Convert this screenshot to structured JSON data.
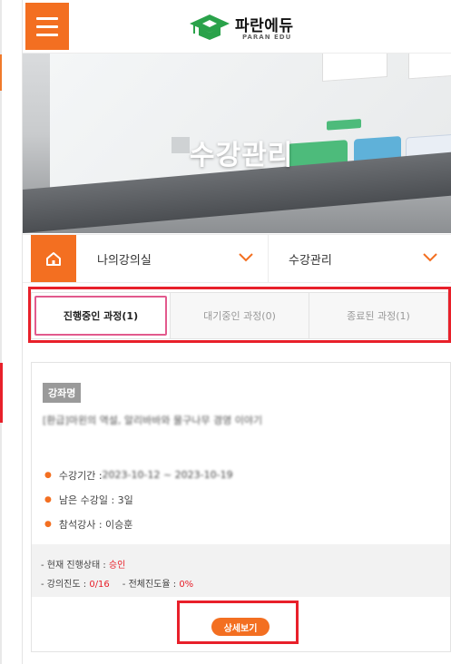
{
  "header": {
    "logo_text": "파란에듀",
    "logo_sub": "PARAN EDU"
  },
  "hero": {
    "title": "수강관리"
  },
  "nav": {
    "item1": "나의강의실",
    "item2": "수강관리"
  },
  "tabs": [
    {
      "label": "진행중인 과정(1)",
      "active": true
    },
    {
      "label": "대기중인 과정(0)",
      "active": false
    },
    {
      "label": "종료된 과정(1)",
      "active": false
    }
  ],
  "course": {
    "badge": "강좌명",
    "title": "[환급]마왼의 역설, 알리바바와 물구나무 경영 이야기",
    "period_label": "수강기간 : ",
    "period_value": "2023-10-12 ~ 2023-10-19",
    "remaining": "남은 수강일 : 3일",
    "instructor": "참석강사 : 이승훈",
    "status_label": "- 현재 진행상태 : ",
    "status_value": "승인",
    "progress_label": "- 강의진도 : ",
    "progress_value": "0/16",
    "overall_label": "- 전체진도율 : ",
    "overall_value": "0%",
    "detail_button": "상세보기"
  },
  "colors": {
    "accent": "#f36f21",
    "highlight": "#e8202a"
  }
}
